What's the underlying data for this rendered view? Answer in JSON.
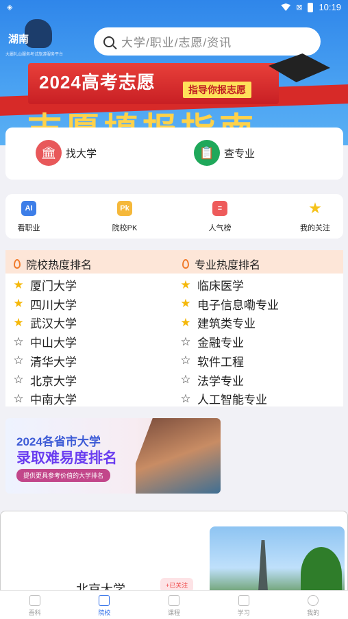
{
  "status_bar": {
    "time": "10:19"
  },
  "header": {
    "region": "湖南",
    "logo_tagline": "大麗礼山服务考试旅游服务平台",
    "search_placeholder": "大学/职业/志愿/资讯"
  },
  "hero_banner": {
    "title": "2024高考志愿",
    "tag": "指导你报志愿",
    "subtitle": "志愿填报指南"
  },
  "quick_entries": [
    {
      "label": "找大学",
      "icon": "university-icon",
      "color": "#e8585a"
    },
    {
      "label": "查专业",
      "icon": "document-search-icon",
      "color": "#1fa85a"
    }
  ],
  "menu": [
    {
      "label": "看职业",
      "icon": "ai-icon",
      "icon_text": "AI",
      "color": "#3d7ee8"
    },
    {
      "label": "院校PK",
      "icon": "pk-icon",
      "icon_text": "Pk",
      "color": "#f5b83a"
    },
    {
      "label": "人气榜",
      "icon": "popular-list-icon",
      "icon_text": "≡",
      "color": "#ee5b5b"
    },
    {
      "label": "我的关注",
      "icon": "star-icon",
      "icon_text": "★",
      "color": "#f5c21a"
    }
  ],
  "rankings": {
    "schools_title": "院校热度排名",
    "majors_title": "专业热度排名",
    "schools": [
      {
        "name": "厦门大学",
        "starred": true
      },
      {
        "name": "四川大学",
        "starred": true
      },
      {
        "name": "武汉大学",
        "starred": true
      },
      {
        "name": "中山大学",
        "starred": false
      },
      {
        "name": "清华大学",
        "starred": false
      },
      {
        "name": "北京大学",
        "starred": false
      },
      {
        "name": "中南大学",
        "starred": false
      }
    ],
    "majors": [
      {
        "name": "临床医学",
        "starred": true
      },
      {
        "name": "电子信息嘞专业",
        "starred": true
      },
      {
        "name": "建筑类专业",
        "starred": true
      },
      {
        "name": "金融专业",
        "starred": false
      },
      {
        "name": "软件工程",
        "starred": false
      },
      {
        "name": "法学专业",
        "starred": false
      },
      {
        "name": "人工智能专业",
        "starred": false
      }
    ]
  },
  "promo": {
    "line1": "2024各省市大学",
    "line2": "录取难易度排名",
    "line3": "提供更具参考价值的大学排名"
  },
  "university_card": {
    "name": "北京大学",
    "follow_label": "+已关注"
  },
  "bottom_nav": [
    {
      "label": "吾科",
      "icon": "box-icon",
      "active": false
    },
    {
      "label": "院校",
      "icon": "gift-icon",
      "active": true
    },
    {
      "label": "课程",
      "icon": "gift-icon",
      "active": false
    },
    {
      "label": "学习",
      "icon": "box-icon",
      "active": false
    },
    {
      "label": "我的",
      "icon": "user-icon",
      "active": false
    }
  ]
}
